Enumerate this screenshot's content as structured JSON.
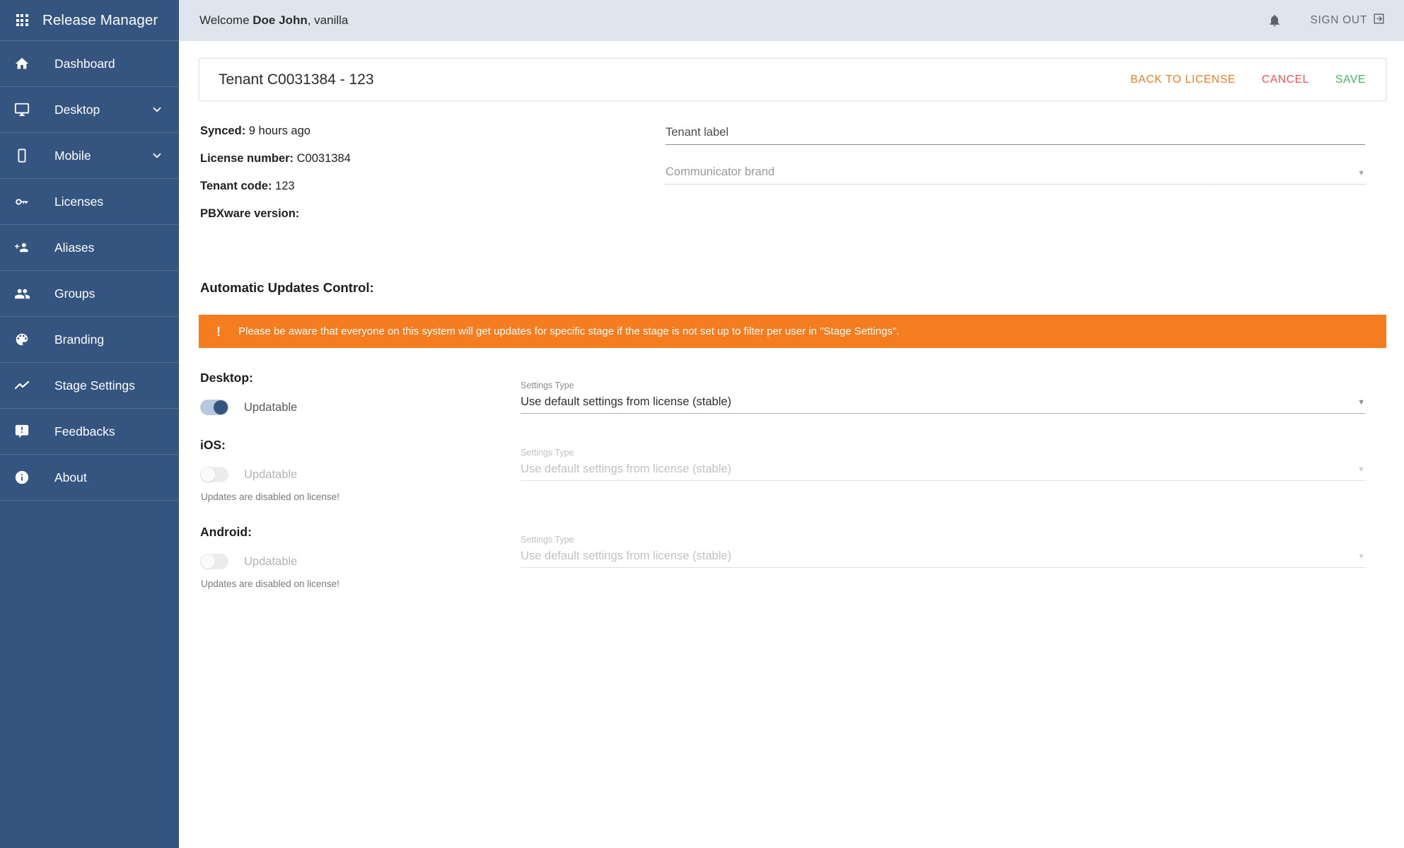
{
  "sidebar": {
    "brand": {
      "title": "Release Manager",
      "icon": "apps-grid-icon"
    },
    "items": [
      {
        "label": "Dashboard",
        "icon": "home-icon",
        "expandable": false
      },
      {
        "label": "Desktop",
        "icon": "monitor-icon",
        "expandable": true
      },
      {
        "label": "Mobile",
        "icon": "phone-icon",
        "expandable": true
      },
      {
        "label": "Licenses",
        "icon": "key-icon",
        "expandable": false
      },
      {
        "label": "Aliases",
        "icon": "person-add-icon",
        "expandable": false
      },
      {
        "label": "Groups",
        "icon": "people-icon",
        "expandable": false
      },
      {
        "label": "Branding",
        "icon": "palette-icon",
        "expandable": false
      },
      {
        "label": "Stage Settings",
        "icon": "trending-icon",
        "expandable": false
      },
      {
        "label": "Feedbacks",
        "icon": "feedback-icon",
        "expandable": false
      },
      {
        "label": "About",
        "icon": "info-icon",
        "expandable": false
      }
    ]
  },
  "topbar": {
    "welcome_prefix": "Welcome ",
    "user_name": "Doe John",
    "welcome_suffix": ", vanilla",
    "bell_icon": "notification-bell-icon",
    "signout_label": "SIGN OUT",
    "signout_icon": "exit-to-app-icon"
  },
  "card": {
    "title": "Tenant C0031384 - 123",
    "actions": {
      "back": "BACK TO LICENSE",
      "cancel": "CANCEL",
      "save": "SAVE"
    }
  },
  "info": {
    "rows": [
      {
        "label": "Synced:",
        "value": "9 hours ago"
      },
      {
        "label": "License number:",
        "value": "C0031384"
      },
      {
        "label": "Tenant code:",
        "value": "123"
      },
      {
        "label": "PBXware version:",
        "value": ""
      }
    ]
  },
  "form": {
    "tenant_label": {
      "placeholder": "Tenant label",
      "value": ""
    },
    "communicator_brand": {
      "placeholder": "Communicator brand",
      "value": "",
      "disabled": true
    }
  },
  "updates": {
    "section_title": "Automatic Updates Control:",
    "alert": {
      "icon": "!",
      "text": "Please be aware that everyone on this system will get updates for specific stage if the stage is not set up to filter per user in \"Stage Settings\"."
    },
    "platforms": [
      {
        "name": "Desktop:",
        "toggle_label": "Updatable",
        "toggle_on": true,
        "disabled": false,
        "note": "",
        "settings_label": "Settings Type",
        "settings_value": "Use default settings from license (stable)"
      },
      {
        "name": "iOS:",
        "toggle_label": "Updatable",
        "toggle_on": false,
        "disabled": true,
        "note": "Updates are disabled on license!",
        "settings_label": "Settings Type",
        "settings_value": "Use default settings from license (stable)"
      },
      {
        "name": "Android:",
        "toggle_label": "Updatable",
        "toggle_on": false,
        "disabled": true,
        "note": "Updates are disabled on license!",
        "settings_label": "Settings Type",
        "settings_value": "Use default settings from license (stable)"
      }
    ]
  },
  "colors": {
    "sidebar_bg": "#33557f",
    "topbar_bg": "#dee5ec",
    "alert_bg": "#f57c1f",
    "action_back": "#f47b20",
    "action_cancel": "#fb5058",
    "action_save": "#41b55b",
    "toggle_on": "#33557f"
  }
}
